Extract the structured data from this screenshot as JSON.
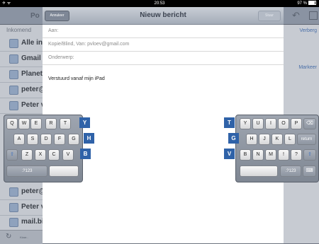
{
  "status_bar": {
    "time": "20:53",
    "left_icons": "✈ ᯤ",
    "battery": "97 %"
  },
  "background_app": {
    "title": "Po",
    "section_inbox": "Inkomend",
    "mailboxes_top": [
      "Alle ink",
      "Gmail",
      "Planet",
      "peter@",
      "Peter v"
    ],
    "mailboxes_bottom": [
      "peter@",
      "Peter v",
      "mail.bij"
    ],
    "right_links": [
      "Verberg",
      "Markeer"
    ],
    "bottom_text": "Klaar..."
  },
  "compose": {
    "cancel_label": "Annuleer",
    "title": "Nieuw bericht",
    "send_label": "Stuur",
    "to_label": "Aan:",
    "cc_label": "Kopie/Blind, Van: pvloev@gmail.com",
    "subject_label": "Onderwerp:",
    "body": "Verstuurd vanaf mijn iPad"
  },
  "keyboard_left": {
    "row1": [
      "Q",
      "W",
      "E",
      "R",
      "T"
    ],
    "row2": [
      "A",
      "S",
      "D",
      "F",
      "G"
    ],
    "row3": [
      "Z",
      "X",
      "C",
      "V"
    ],
    "numbers_key": ".?123",
    "shift_glyph": "⇧"
  },
  "keyboard_right": {
    "row1": [
      "Y",
      "U",
      "I",
      "O",
      "P"
    ],
    "row2": [
      "H",
      "J",
      "K",
      "L"
    ],
    "row3": [
      "B",
      "N",
      "M",
      "!",
      "?"
    ],
    "return_label": "return",
    "delete_glyph": "⌫",
    "shift_glyph": "⇧",
    "numbers_key": ".?123",
    "hide_keyboard_glyph": "⌨"
  },
  "ghost_keys": {
    "left": [
      "Y",
      "H",
      "B"
    ],
    "right": [
      "T",
      "G",
      "V"
    ],
    "color": "#2f62a8"
  }
}
